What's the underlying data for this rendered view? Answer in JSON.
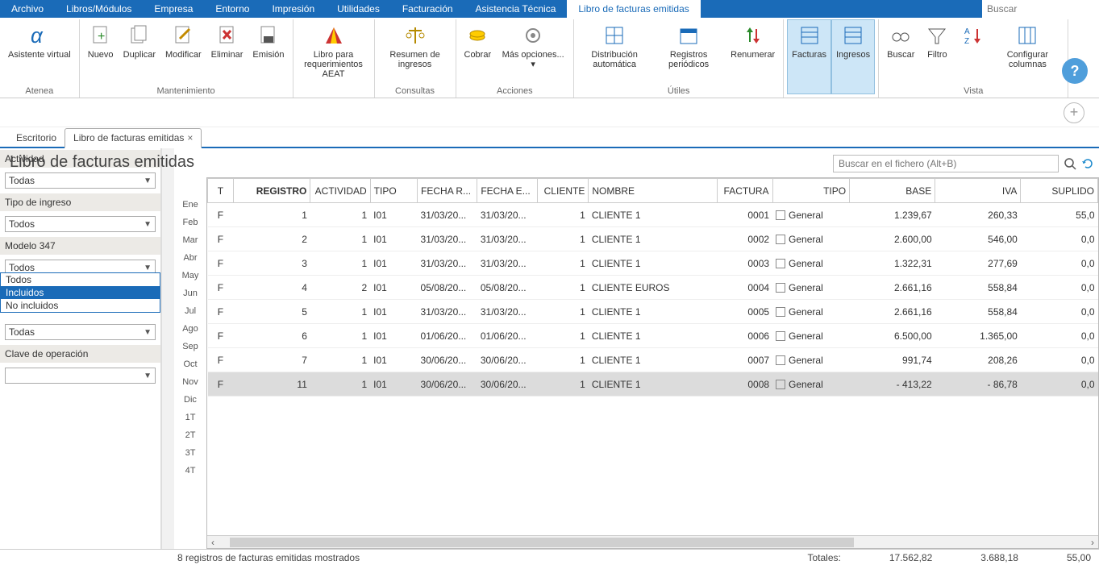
{
  "menubar": {
    "items": [
      "Archivo",
      "Libros/Módulos",
      "Empresa",
      "Entorno",
      "Impresión",
      "Utilidades",
      "Facturación",
      "Asistencia Técnica",
      "Libro de facturas emitidas"
    ],
    "search_placeholder": "Buscar"
  },
  "ribbon": {
    "groups": [
      {
        "label": "Atenea",
        "buttons": [
          {
            "label": "Asistente virtual"
          }
        ]
      },
      {
        "label": "Mantenimiento",
        "buttons": [
          {
            "label": "Nuevo"
          },
          {
            "label": "Duplicar"
          },
          {
            "label": "Modificar"
          },
          {
            "label": "Eliminar"
          },
          {
            "label": "Emisión"
          }
        ]
      },
      {
        "label": "",
        "buttons": [
          {
            "label": "Libro para requerimientos AEAT"
          }
        ]
      },
      {
        "label": "Consultas",
        "buttons": [
          {
            "label": "Resumen de ingresos"
          }
        ]
      },
      {
        "label": "Acciones",
        "buttons": [
          {
            "label": "Cobrar"
          },
          {
            "label": "Más opciones... ▾"
          }
        ]
      },
      {
        "label": "Útiles",
        "buttons": [
          {
            "label": "Distribución automática"
          },
          {
            "label": "Registros periódicos"
          },
          {
            "label": "Renumerar"
          }
        ]
      },
      {
        "label": "",
        "buttons": [
          {
            "label": "Facturas",
            "active": true
          },
          {
            "label": "Ingresos",
            "active": true
          }
        ]
      },
      {
        "label": "Vista",
        "buttons": [
          {
            "label": "Buscar"
          },
          {
            "label": "Filtro"
          },
          {
            "label": "↓↑"
          },
          {
            "label": "Configurar columnas"
          }
        ]
      }
    ]
  },
  "tabs": {
    "items": [
      {
        "label": "Escritorio",
        "active": false,
        "closable": false
      },
      {
        "label": "Libro de facturas emitidas",
        "active": true,
        "closable": true
      }
    ]
  },
  "page_title": "Libro de facturas emitidas",
  "filters": {
    "actividad": {
      "label": "Actividad",
      "value": "Todas"
    },
    "tipo_ingreso": {
      "label": "Tipo de ingreso",
      "value": "Todos"
    },
    "modelo347": {
      "label": "Modelo 347",
      "value": "Todos",
      "options": [
        "Todos",
        "Incluidos",
        "No incluidos"
      ],
      "highlight": "Incluidos"
    },
    "unnamed": {
      "value": "Todas"
    },
    "clave": {
      "label": "Clave de operación"
    }
  },
  "months": [
    "Ene",
    "Feb",
    "Mar",
    "Abr",
    "May",
    "Jun",
    "Jul",
    "Ago",
    "Sep",
    "Oct",
    "Nov",
    "Dic",
    "1T",
    "2T",
    "3T",
    "4T"
  ],
  "file_search": {
    "placeholder": "Buscar en el fichero (Alt+B)"
  },
  "table": {
    "headers": [
      "T",
      "REGISTRO",
      "ACTIVIDAD",
      "TIPO",
      "FECHA R...",
      "FECHA E...",
      "CLIENTE",
      "NOMBRE",
      "FACTURA",
      "TIPO",
      "BASE",
      "IVA",
      "SUPLIDO"
    ],
    "rows": [
      {
        "t": "F",
        "reg": "1",
        "act": "1",
        "tipo": "I01",
        "fr": "31/03/20...",
        "fe": "31/03/20...",
        "cli": "1",
        "nom": "CLIENTE 1",
        "fac": "0001",
        "tipo2": "General",
        "base": "1.239,67",
        "iva": "260,33",
        "sup": "55,0"
      },
      {
        "t": "F",
        "reg": "2",
        "act": "1",
        "tipo": "I01",
        "fr": "31/03/20...",
        "fe": "31/03/20...",
        "cli": "1",
        "nom": "CLIENTE 1",
        "fac": "0002",
        "tipo2": "General",
        "base": "2.600,00",
        "iva": "546,00",
        "sup": "0,0"
      },
      {
        "t": "F",
        "reg": "3",
        "act": "1",
        "tipo": "I01",
        "fr": "31/03/20...",
        "fe": "31/03/20...",
        "cli": "1",
        "nom": "CLIENTE 1",
        "fac": "0003",
        "tipo2": "General",
        "base": "1.322,31",
        "iva": "277,69",
        "sup": "0,0"
      },
      {
        "t": "F",
        "reg": "4",
        "act": "2",
        "tipo": "I01",
        "fr": "05/08/20...",
        "fe": "05/08/20...",
        "cli": "1",
        "nom": "CLIENTE EUROS",
        "fac": "0004",
        "tipo2": "General",
        "base": "2.661,16",
        "iva": "558,84",
        "sup": "0,0"
      },
      {
        "t": "F",
        "reg": "5",
        "act": "1",
        "tipo": "I01",
        "fr": "31/03/20...",
        "fe": "31/03/20...",
        "cli": "1",
        "nom": "CLIENTE 1",
        "fac": "0005",
        "tipo2": "General",
        "base": "2.661,16",
        "iva": "558,84",
        "sup": "0,0"
      },
      {
        "t": "F",
        "reg": "6",
        "act": "1",
        "tipo": "I01",
        "fr": "01/06/20...",
        "fe": "01/06/20...",
        "cli": "1",
        "nom": "CLIENTE 1",
        "fac": "0006",
        "tipo2": "General",
        "base": "6.500,00",
        "iva": "1.365,00",
        "sup": "0,0"
      },
      {
        "t": "F",
        "reg": "7",
        "act": "1",
        "tipo": "I01",
        "fr": "30/06/20...",
        "fe": "30/06/20...",
        "cli": "1",
        "nom": "CLIENTE 1",
        "fac": "0007",
        "tipo2": "General",
        "base": "991,74",
        "iva": "208,26",
        "sup": "0,0"
      },
      {
        "t": "F",
        "reg": "11",
        "act": "1",
        "tipo": "I01",
        "fr": "30/06/20...",
        "fe": "30/06/20...",
        "cli": "1",
        "nom": "CLIENTE 1",
        "fac": "0008",
        "tipo2": "General",
        "base": "- 413,22",
        "iva": "- 86,78",
        "sup": "0,0",
        "selected": true
      }
    ]
  },
  "status": {
    "count_text": "8 registros de facturas emitidas mostrados",
    "totales_label": "Totales:",
    "base": "17.562,82",
    "iva": "3.688,18",
    "sup": "55,00"
  }
}
